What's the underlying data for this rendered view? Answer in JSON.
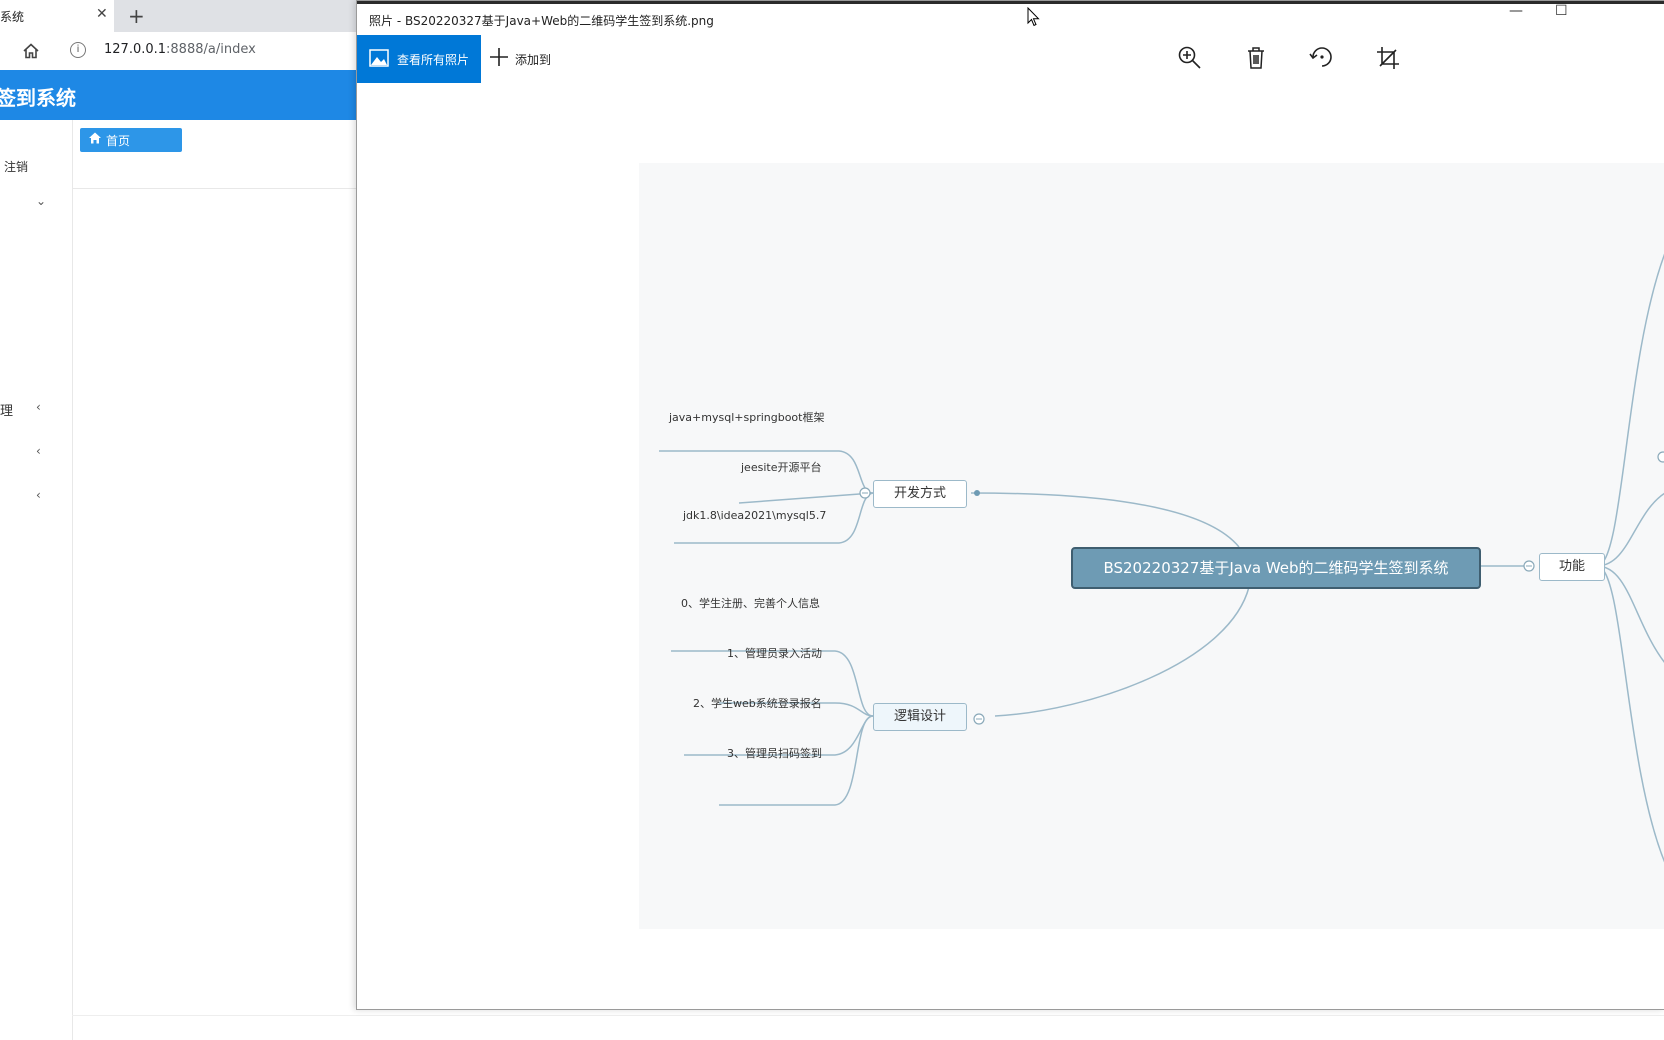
{
  "browser": {
    "tab_title": "系统",
    "tab_close": "✕",
    "new_tab": "+",
    "url_host": "127.0.0.1",
    "url_rest": ":8888/a/index",
    "info_glyph": "i"
  },
  "app": {
    "header_title": "签到系统",
    "logout_label": "注销",
    "menu_partial_label": "理",
    "home_tab_label": "首页",
    "chevron_down": "⌄",
    "chevron_left": "‹"
  },
  "photos": {
    "window_title": "照片 - BS20220327基于Java+Web的二维码学生签到系统.png",
    "minimize": "—",
    "maximize": "☐",
    "view_all_label": "查看所有照片",
    "add_to_label": "添加到",
    "tools": [
      "zoom-in-icon",
      "delete-icon",
      "rotate-icon",
      "crop-icon"
    ]
  },
  "mindmap": {
    "root": "BS20220327基于Java Web的二维码学生签到系统",
    "branches": [
      {
        "label": "开发方式",
        "items": [
          "java+mysql+springboot框架",
          "jeesite开源平台",
          "jdk1.8\\idea2021\\mysql5.7"
        ]
      },
      {
        "label": "逻辑设计",
        "items": [
          "0、学生注册、完善个人信息",
          "1、管理员录入活动",
          "2、学生web系统登录报名",
          "3、管理员扫码签到"
        ]
      },
      {
        "label": "功能",
        "items": []
      }
    ]
  },
  "colors": {
    "browser_accent": "#1e88e5",
    "photos_accent": "#0078d7",
    "root_fill": "#6e9bb4",
    "connector": "#9cb9c9"
  }
}
